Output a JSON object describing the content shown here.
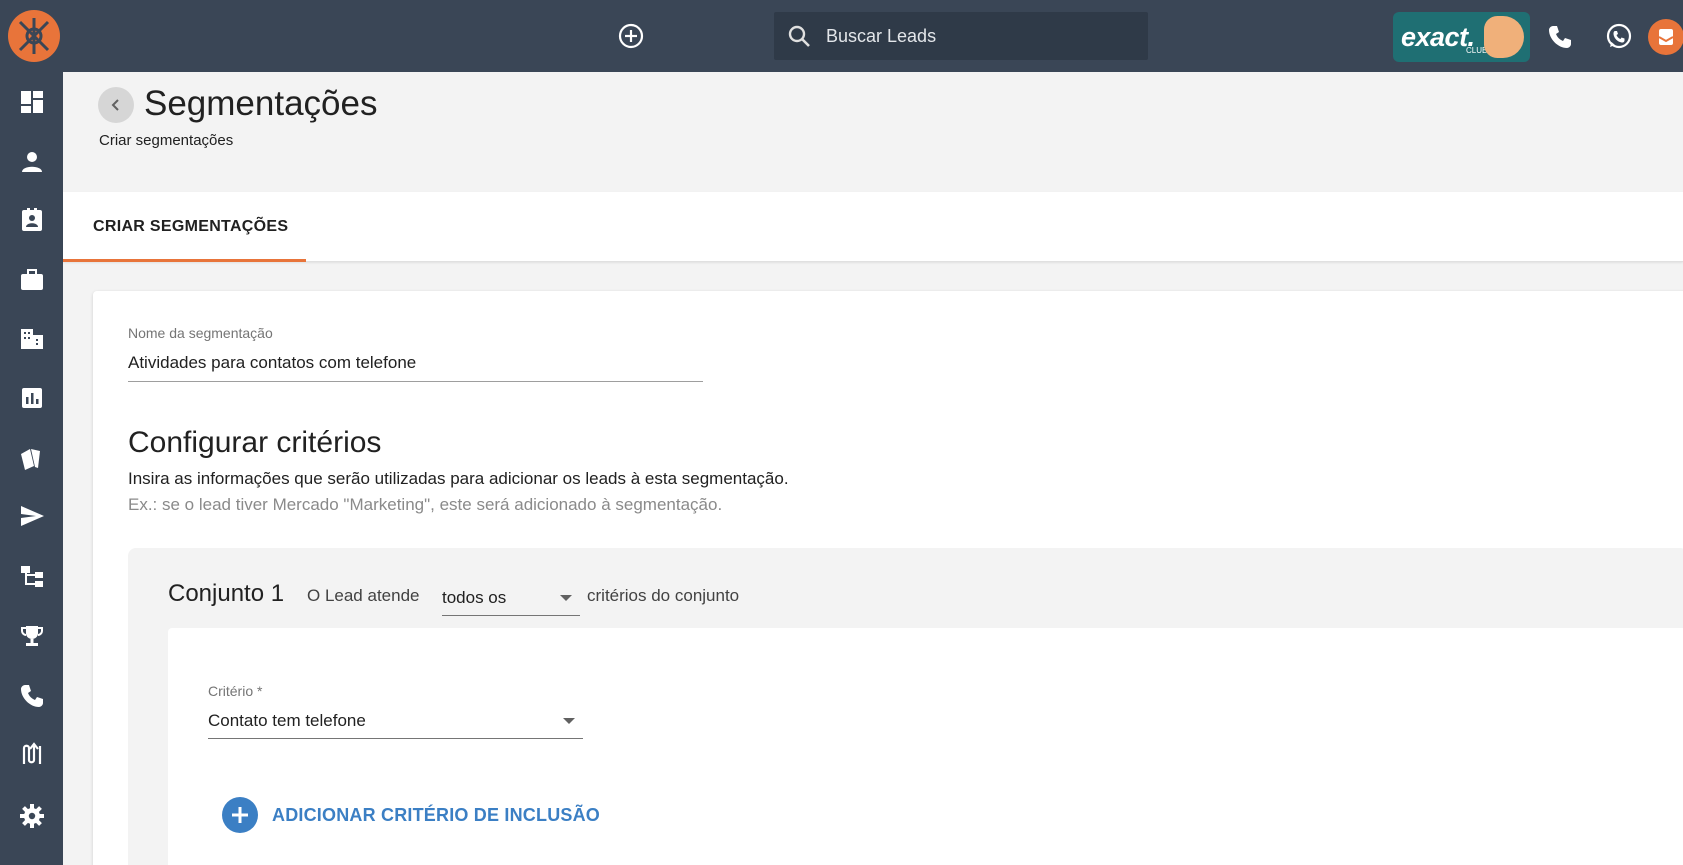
{
  "topbar": {
    "search_placeholder": "Buscar Leads",
    "club_text": "exact.",
    "club_sub": "CLUB"
  },
  "sidebar": {
    "items": [
      {
        "name": "dashboard-icon"
      },
      {
        "name": "person-icon"
      },
      {
        "name": "contact-card-icon"
      },
      {
        "name": "briefcase-icon"
      },
      {
        "name": "building-icon"
      },
      {
        "name": "bar-chart-icon"
      },
      {
        "name": "cards-icon"
      },
      {
        "name": "send-icon"
      },
      {
        "name": "hierarchy-icon"
      },
      {
        "name": "trophy-icon"
      },
      {
        "name": "phone-icon"
      },
      {
        "name": "flow-icon"
      },
      {
        "name": "settings-icon"
      }
    ]
  },
  "header": {
    "title": "Segmentações",
    "subtitle": "Criar segmentações"
  },
  "tabs": [
    {
      "label": "CRIAR SEGMENTAÇÕES",
      "active": true
    }
  ],
  "form": {
    "name_label": "Nome da segmentação",
    "name_value": "Atividades para contatos com telefone",
    "section_title": "Configurar critérios",
    "section_desc": "Insira as informações que serão utilizadas para adicionar os leads à esta segmentação.",
    "section_example": "Ex.: se o lead tiver Mercado \"Marketing\", este será adicionado à segmentação."
  },
  "group": {
    "title": "Conjunto 1",
    "text_before": "O Lead atende",
    "match_value": "todos os",
    "text_after": "critérios do conjunto",
    "criterion_label": "Critério *",
    "criterion_value": "Contato tem telefone",
    "add_label": "ADICIONAR CRITÉRIO DE INCLUSÃO"
  },
  "colors": {
    "topbar": "#3a4656",
    "accent": "#e8743a",
    "link": "#3b7fc4",
    "club": "#1f6f73"
  }
}
